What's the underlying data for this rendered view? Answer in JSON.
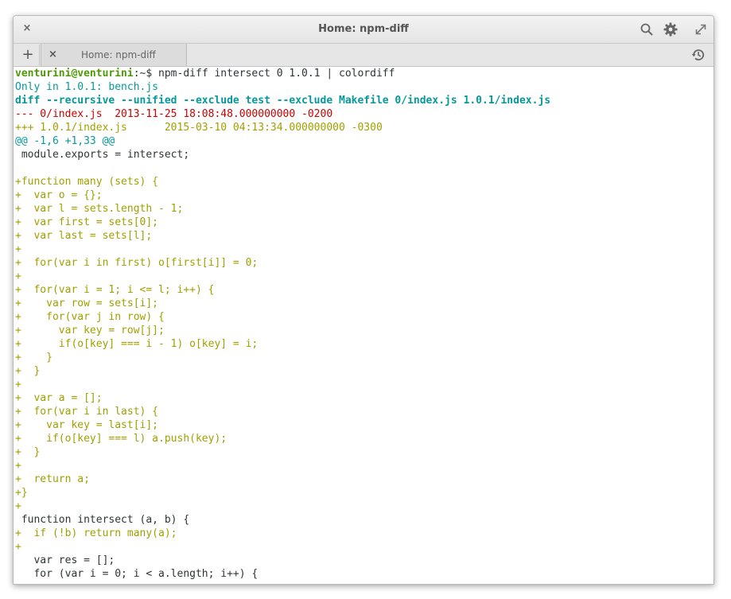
{
  "window": {
    "title": "Home: npm-diff",
    "close_glyph": "×"
  },
  "tabbar": {
    "new_tab_glyph": "+",
    "tab": {
      "close_glyph": "×",
      "label": "Home: npm-diff"
    }
  },
  "icons": {
    "close": "close-icon",
    "search": "search-icon",
    "settings": "gear-icon",
    "maximize": "maximize-icon",
    "new_tab": "plus-icon",
    "history": "history-icon"
  },
  "colors": {
    "prompt": "#4e9a06",
    "info": "#06989a",
    "removed": "#cc0000",
    "added": "#a0a000",
    "text": "#2e3436"
  },
  "terminal": {
    "prompt_user": "venturini@venturini",
    "prompt_path": ":~$ ",
    "command": "npm-diff intersect 0 1.0.1 | colordiff",
    "lines": [
      {
        "style": "only",
        "text": "Only in 1.0.1: bench.js"
      },
      {
        "style": "diff",
        "text": "diff --recursive --unified --exclude test --exclude Makefile 0/index.js 1.0.1/index.js"
      },
      {
        "style": "minus",
        "text": "--- 0/index.js  2013-11-25 18:08:48.000000000 -0200"
      },
      {
        "style": "plus",
        "text": "+++ 1.0.1/index.js      2015-03-10 04:13:34.000000000 -0300"
      },
      {
        "style": "hunk",
        "text": "@@ -1,6 +1,33 @@"
      },
      {
        "style": "default",
        "text": " module.exports = intersect;"
      },
      {
        "style": "default",
        "text": ""
      },
      {
        "style": "plus",
        "text": "+function many (sets) {"
      },
      {
        "style": "plus",
        "text": "+  var o = {};"
      },
      {
        "style": "plus",
        "text": "+  var l = sets.length - 1;"
      },
      {
        "style": "plus",
        "text": "+  var first = sets[0];"
      },
      {
        "style": "plus",
        "text": "+  var last = sets[l];"
      },
      {
        "style": "plus",
        "text": "+"
      },
      {
        "style": "plus",
        "text": "+  for(var i in first) o[first[i]] = 0;"
      },
      {
        "style": "plus",
        "text": "+"
      },
      {
        "style": "plus",
        "text": "+  for(var i = 1; i <= l; i++) {"
      },
      {
        "style": "plus",
        "text": "+    var row = sets[i];"
      },
      {
        "style": "plus",
        "text": "+    for(var j in row) {"
      },
      {
        "style": "plus",
        "text": "+      var key = row[j];"
      },
      {
        "style": "plus",
        "text": "+      if(o[key] === i - 1) o[key] = i;"
      },
      {
        "style": "plus",
        "text": "+    }"
      },
      {
        "style": "plus",
        "text": "+  }"
      },
      {
        "style": "plus",
        "text": "+"
      },
      {
        "style": "plus",
        "text": "+  var a = [];"
      },
      {
        "style": "plus",
        "text": "+  for(var i in last) {"
      },
      {
        "style": "plus",
        "text": "+    var key = last[i];"
      },
      {
        "style": "plus",
        "text": "+    if(o[key] === l) a.push(key);"
      },
      {
        "style": "plus",
        "text": "+  }"
      },
      {
        "style": "plus",
        "text": "+"
      },
      {
        "style": "plus",
        "text": "+  return a;"
      },
      {
        "style": "plus",
        "text": "+}"
      },
      {
        "style": "plus",
        "text": "+"
      },
      {
        "style": "default",
        "text": " function intersect (a, b) {"
      },
      {
        "style": "plus",
        "text": "+  if (!b) return many(a);"
      },
      {
        "style": "plus",
        "text": "+"
      },
      {
        "style": "default",
        "text": "   var res = [];"
      },
      {
        "style": "default",
        "text": "   for (var i = 0; i < a.length; i++) {"
      }
    ]
  }
}
